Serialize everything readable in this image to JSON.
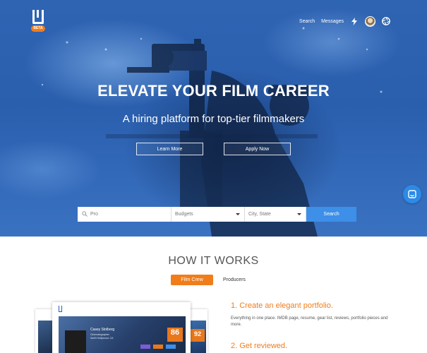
{
  "brand": {
    "badge": "BETA"
  },
  "nav": {
    "search": "Search",
    "messages": "Messages",
    "icons": [
      "lightning-icon",
      "avatar",
      "aperture-icon"
    ]
  },
  "hero": {
    "title": "ELEVATE YOUR FILM CAREER",
    "subtitle": "A hiring platform for top-tier filmmakers",
    "learn_more": "Learn More",
    "apply_now": "Apply Now"
  },
  "search": {
    "keyword_value": "Pro",
    "budgets_value": "Budgets",
    "location_value": "City, State",
    "button": "Search"
  },
  "how": {
    "title": "HOW IT WORKS",
    "tabs": [
      {
        "label": "Film Crew",
        "active": true
      },
      {
        "label": "Producers",
        "active": false
      }
    ],
    "steps": [
      {
        "title": "1. Create an elegant portfolio.",
        "desc": "Everything in one place. IMDB page, resume, gear list, reviews, portfolio pieces and more."
      },
      {
        "title": "2. Get reviewed."
      }
    ],
    "mockup": {
      "name": "Casey Stolberg",
      "role_line1": "Cinematographer",
      "role_line2": "North Hollywood, CA",
      "score": "86",
      "score_back": "92"
    }
  },
  "colors": {
    "accent_orange": "#f07d1a",
    "search_blue": "#3d8fe8",
    "hero_blue": "#2f64b3"
  }
}
